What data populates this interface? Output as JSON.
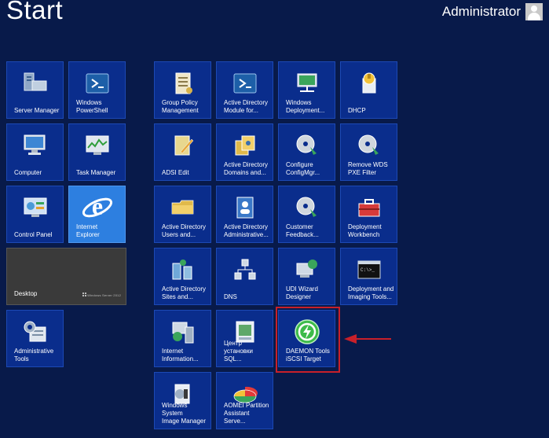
{
  "screen": {
    "title": "Start"
  },
  "user": {
    "name": "Administrator",
    "avatar_icon": "user-avatar-icon"
  },
  "tiles": {
    "server_manager": {
      "label": "Server Manager",
      "icon": "server-icon"
    },
    "powershell": {
      "label": "Windows\nPowerShell",
      "icon": "powershell-icon"
    },
    "group_policy": {
      "label": "Group Policy\nManagement",
      "icon": "scroll-icon"
    },
    "ad_module": {
      "label": "Active Directory\nModule for...",
      "icon": "powershell-icon"
    },
    "windows_deploy": {
      "label": "Windows\nDeployment...",
      "icon": "network-monitor-icon"
    },
    "dhcp": {
      "label": "DHCP",
      "icon": "dhcp-icon"
    },
    "computer": {
      "label": "Computer",
      "icon": "computer-icon"
    },
    "task_manager": {
      "label": "Task Manager",
      "icon": "task-manager-icon"
    },
    "adsi_edit": {
      "label": "ADSI Edit",
      "icon": "adsi-edit-icon"
    },
    "ad_domains": {
      "label": "Active Directory\nDomains and...",
      "icon": "ad-domains-icon"
    },
    "configure_cm": {
      "label": "Configure\nConfigMgr...",
      "icon": "disc-icon"
    },
    "remove_wds": {
      "label": "Remove WDS\nPXE Filter",
      "icon": "disc-icon"
    },
    "control_panel": {
      "label": "Control Panel",
      "icon": "control-panel-icon"
    },
    "internet_explorer": {
      "label": "Internet Explorer",
      "icon": "internet-explorer-icon"
    },
    "ad_users": {
      "label": "Active Directory\nUsers and...",
      "icon": "folder-icon"
    },
    "ad_admin": {
      "label": "Active Directory\nAdministrative...",
      "icon": "ad-admin-center-icon"
    },
    "customer_feedback": {
      "label": "Customer\nFeedback...",
      "icon": "disc-icon"
    },
    "deploy_workbench": {
      "label": "Deployment\nWorkbench",
      "icon": "toolbox-icon"
    },
    "desktop": {
      "label": "Desktop",
      "logo_text": "Windows Server 2012",
      "icon": "windows-logo-icon"
    },
    "ad_sites": {
      "label": "Active Directory\nSites and...",
      "icon": "ad-sites-icon"
    },
    "dns": {
      "label": "DNS",
      "icon": "dns-icon"
    },
    "udi_wizard": {
      "label": "UDI Wizard\nDesigner",
      "icon": "udi-wizard-icon"
    },
    "deploy_imaging": {
      "label": "Deployment and\nImaging Tools...",
      "icon": "command-prompt-icon"
    },
    "admin_tools": {
      "label": "Administrative\nTools",
      "icon": "admin-tools-icon"
    },
    "internet_info": {
      "label": "Internet\nInformation...",
      "icon": "iis-icon"
    },
    "sql_setup": {
      "label": "Центр\nустановки SQL...",
      "icon": "sql-setup-icon"
    },
    "daemon_tools": {
      "label": "DAEMON Tools\niSCSI Target",
      "icon": "daemon-tools-icon"
    },
    "system_image": {
      "label": "Windows System\nImage Manager",
      "icon": "system-image-icon"
    },
    "aomei": {
      "label": "AOMEI Partition\nAssistant Serve...",
      "icon": "aomei-partition-icon"
    }
  },
  "annotation": {
    "highlight_color": "#c8202a",
    "arrow_color": "#c8202a"
  }
}
